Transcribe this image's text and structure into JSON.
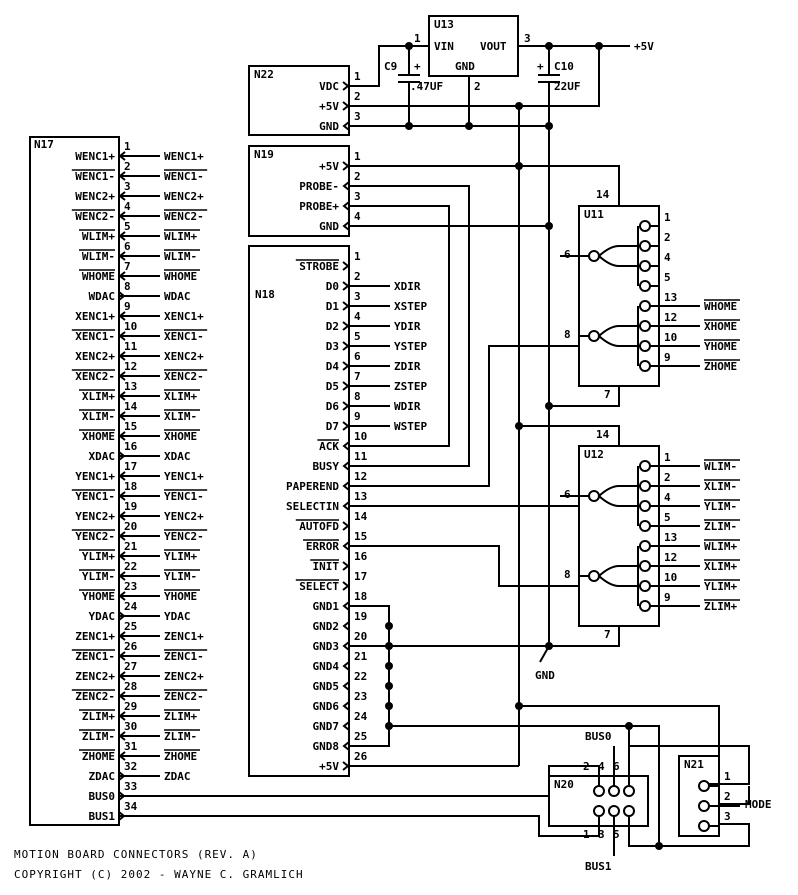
{
  "title_lines": [
    "MOTION BOARD CONNECTORS (REV. A)",
    "COPYRIGHT (C) 2002 - WAYNE C. GRAMLICH"
  ],
  "colors": {
    "ink": "#000000",
    "background": "#ffffff"
  },
  "n17": {
    "ref": "N17",
    "pins": [
      {
        "pin": "1",
        "name": "WENC1+",
        "bar": false,
        "dir": "in",
        "net": "WENC1+"
      },
      {
        "pin": "2",
        "name": "WENC1-",
        "bar": true,
        "dir": "in",
        "net": "WENC1-"
      },
      {
        "pin": "3",
        "name": "WENC2+",
        "bar": false,
        "dir": "in",
        "net": "WENC2+"
      },
      {
        "pin": "4",
        "name": "WENC2-",
        "bar": true,
        "dir": "in",
        "net": "WENC2-"
      },
      {
        "pin": "5",
        "name": "WLIM+",
        "bar": true,
        "dir": "in",
        "net": "WLIM+"
      },
      {
        "pin": "6",
        "name": "WLIM-",
        "bar": true,
        "dir": "in",
        "net": "WLIM-"
      },
      {
        "pin": "7",
        "name": "WHOME",
        "bar": true,
        "dir": "in",
        "net": "WHOME"
      },
      {
        "pin": "8",
        "name": "WDAC",
        "bar": false,
        "dir": "out",
        "net": "WDAC"
      },
      {
        "pin": "9",
        "name": "XENC1+",
        "bar": false,
        "dir": "in",
        "net": "XENC1+"
      },
      {
        "pin": "10",
        "name": "XENC1-",
        "bar": true,
        "dir": "in",
        "net": "XENC1-"
      },
      {
        "pin": "11",
        "name": "XENC2+",
        "bar": false,
        "dir": "in",
        "net": "XENC2+"
      },
      {
        "pin": "12",
        "name": "XENC2-",
        "bar": true,
        "dir": "in",
        "net": "XENC2-"
      },
      {
        "pin": "13",
        "name": "XLIM+",
        "bar": true,
        "dir": "in",
        "net": "XLIM+"
      },
      {
        "pin": "14",
        "name": "XLIM-",
        "bar": true,
        "dir": "in",
        "net": "XLIM-"
      },
      {
        "pin": "15",
        "name": "XHOME",
        "bar": true,
        "dir": "in",
        "net": "XHOME"
      },
      {
        "pin": "16",
        "name": "XDAC",
        "bar": false,
        "dir": "out",
        "net": "XDAC"
      },
      {
        "pin": "17",
        "name": "YENC1+",
        "bar": false,
        "dir": "in",
        "net": "YENC1+"
      },
      {
        "pin": "18",
        "name": "YENC1-",
        "bar": true,
        "dir": "in",
        "net": "YENC1-"
      },
      {
        "pin": "19",
        "name": "YENC2+",
        "bar": false,
        "dir": "in",
        "net": "YENC2+"
      },
      {
        "pin": "20",
        "name": "YENC2-",
        "bar": true,
        "dir": "in",
        "net": "YENC2-"
      },
      {
        "pin": "21",
        "name": "YLIM+",
        "bar": true,
        "dir": "in",
        "net": "YLIM+"
      },
      {
        "pin": "22",
        "name": "YLIM-",
        "bar": true,
        "dir": "in",
        "net": "YLIM-"
      },
      {
        "pin": "23",
        "name": "YHOME",
        "bar": true,
        "dir": "in",
        "net": "YHOME"
      },
      {
        "pin": "24",
        "name": "YDAC",
        "bar": false,
        "dir": "out",
        "net": "YDAC"
      },
      {
        "pin": "25",
        "name": "ZENC1+",
        "bar": false,
        "dir": "in",
        "net": "ZENC1+"
      },
      {
        "pin": "26",
        "name": "ZENC1-",
        "bar": true,
        "dir": "in",
        "net": "ZENC1-"
      },
      {
        "pin": "27",
        "name": "ZENC2+",
        "bar": false,
        "dir": "in",
        "net": "ZENC2+"
      },
      {
        "pin": "28",
        "name": "ZENC2-",
        "bar": true,
        "dir": "in",
        "net": "ZENC2-"
      },
      {
        "pin": "29",
        "name": "ZLIM+",
        "bar": true,
        "dir": "in",
        "net": "ZLIM+"
      },
      {
        "pin": "30",
        "name": "ZLIM-",
        "bar": true,
        "dir": "in",
        "net": "ZLIM-"
      },
      {
        "pin": "31",
        "name": "ZHOME",
        "bar": true,
        "dir": "in",
        "net": "ZHOME"
      },
      {
        "pin": "32",
        "name": "ZDAC",
        "bar": false,
        "dir": "out",
        "net": "ZDAC"
      },
      {
        "pin": "33",
        "name": "BUS0",
        "bar": false,
        "dir": "out",
        "net": ""
      },
      {
        "pin": "34",
        "name": "BUS1",
        "bar": false,
        "dir": "out",
        "net": ""
      }
    ]
  },
  "n22": {
    "ref": "N22",
    "pins": [
      {
        "pin": "1",
        "name": "VDC",
        "dir": "out"
      },
      {
        "pin": "2",
        "name": "+5V",
        "dir": "out"
      },
      {
        "pin": "3",
        "name": "GND",
        "dir": "in"
      }
    ]
  },
  "u13": {
    "ref": "U13",
    "vin": "VIN",
    "vout": "VOUT",
    "gnd": "GND",
    "pin_vin": "1",
    "pin_gnd": "2",
    "pin_vout": "3"
  },
  "c9": {
    "ref": "C9",
    "value": ".47UF",
    "polarity": "+"
  },
  "c10": {
    "ref": "C10",
    "value": "22UF",
    "polarity": "+"
  },
  "supply_label": "+5V",
  "n19": {
    "ref": "N19",
    "pins": [
      {
        "pin": "1",
        "name": "+5V",
        "dir": "out"
      },
      {
        "pin": "2",
        "name": "PROBE-",
        "dir": "in"
      },
      {
        "pin": "3",
        "name": "PROBE+",
        "dir": "in"
      },
      {
        "pin": "4",
        "name": "GND",
        "dir": "in"
      }
    ]
  },
  "n18": {
    "ref": "N18",
    "pins": [
      {
        "pin": "1",
        "name": "STROBE",
        "bar": true,
        "dir": "out",
        "net": ""
      },
      {
        "pin": "2",
        "name": "D0",
        "bar": false,
        "dir": "out",
        "net": "XDIR"
      },
      {
        "pin": "3",
        "name": "D1",
        "bar": false,
        "dir": "out",
        "net": "XSTEP"
      },
      {
        "pin": "4",
        "name": "D2",
        "bar": false,
        "dir": "out",
        "net": "YDIR"
      },
      {
        "pin": "5",
        "name": "D3",
        "bar": false,
        "dir": "out",
        "net": "YSTEP"
      },
      {
        "pin": "6",
        "name": "D4",
        "bar": false,
        "dir": "out",
        "net": "ZDIR"
      },
      {
        "pin": "7",
        "name": "D5",
        "bar": false,
        "dir": "out",
        "net": "ZSTEP"
      },
      {
        "pin": "8",
        "name": "D6",
        "bar": false,
        "dir": "out",
        "net": "WDIR"
      },
      {
        "pin": "9",
        "name": "D7",
        "bar": false,
        "dir": "out",
        "net": "WSTEP"
      },
      {
        "pin": "10",
        "name": "ACK",
        "bar": true,
        "dir": "in",
        "net": ""
      },
      {
        "pin": "11",
        "name": "BUSY",
        "bar": false,
        "dir": "in",
        "net": ""
      },
      {
        "pin": "12",
        "name": "PAPEREND",
        "bar": false,
        "dir": "in",
        "net": ""
      },
      {
        "pin": "13",
        "name": "SELECTIN",
        "bar": false,
        "dir": "in",
        "net": ""
      },
      {
        "pin": "14",
        "name": "AUTOFD",
        "bar": true,
        "dir": "out",
        "net": ""
      },
      {
        "pin": "15",
        "name": "ERROR",
        "bar": true,
        "dir": "in",
        "net": ""
      },
      {
        "pin": "16",
        "name": "INIT",
        "bar": true,
        "dir": "out",
        "net": ""
      },
      {
        "pin": "17",
        "name": "SELECT",
        "bar": true,
        "dir": "out",
        "net": ""
      },
      {
        "pin": "18",
        "name": "GND1",
        "bar": false,
        "dir": "in",
        "net": ""
      },
      {
        "pin": "19",
        "name": "GND2",
        "bar": false,
        "dir": "in",
        "net": ""
      },
      {
        "pin": "20",
        "name": "GND3",
        "bar": false,
        "dir": "in",
        "net": ""
      },
      {
        "pin": "21",
        "name": "GND4",
        "bar": false,
        "dir": "in",
        "net": ""
      },
      {
        "pin": "22",
        "name": "GND5",
        "bar": false,
        "dir": "in",
        "net": ""
      },
      {
        "pin": "23",
        "name": "GND6",
        "bar": false,
        "dir": "in",
        "net": ""
      },
      {
        "pin": "24",
        "name": "GND7",
        "bar": false,
        "dir": "in",
        "net": ""
      },
      {
        "pin": "25",
        "name": "GND8",
        "bar": false,
        "dir": "in",
        "net": ""
      },
      {
        "pin": "26",
        "name": "+5V",
        "bar": false,
        "dir": "out",
        "net": ""
      }
    ]
  },
  "gnd_label": "GND",
  "u11": {
    "ref": "U11",
    "pin_vcc": "14",
    "pin_gnd": "7",
    "pin_out1": "6",
    "pin_out2": "8",
    "inputs": [
      {
        "pin": "1",
        "net": ""
      },
      {
        "pin": "2",
        "net": ""
      },
      {
        "pin": "4",
        "net": ""
      },
      {
        "pin": "5",
        "net": ""
      },
      {
        "pin": "13",
        "net": "WHOME"
      },
      {
        "pin": "12",
        "net": "XHOME"
      },
      {
        "pin": "10",
        "net": "YHOME"
      },
      {
        "pin": "9",
        "net": "ZHOME"
      }
    ]
  },
  "u12": {
    "ref": "U12",
    "pin_vcc": "14",
    "pin_gnd": "7",
    "pin_out1": "6",
    "pin_out2": "8",
    "inputs": [
      {
        "pin": "1",
        "net": "WLIM-"
      },
      {
        "pin": "2",
        "net": "XLIM-"
      },
      {
        "pin": "4",
        "net": "YLIM-"
      },
      {
        "pin": "5",
        "net": "ZLIM-"
      },
      {
        "pin": "13",
        "net": "WLIM+"
      },
      {
        "pin": "12",
        "net": "XLIM+"
      },
      {
        "pin": "10",
        "net": "YLIM+"
      },
      {
        "pin": "9",
        "net": "ZLIM+"
      }
    ]
  },
  "n20": {
    "ref": "N20",
    "top_pins": [
      "2",
      "4",
      "6"
    ],
    "bottom_pins": [
      "1",
      "3",
      "5"
    ],
    "label_top": "BUS0",
    "label_bottom": "BUS1"
  },
  "n21": {
    "ref": "N21",
    "pins": [
      "1",
      "2",
      "3"
    ],
    "label": "MODE"
  }
}
